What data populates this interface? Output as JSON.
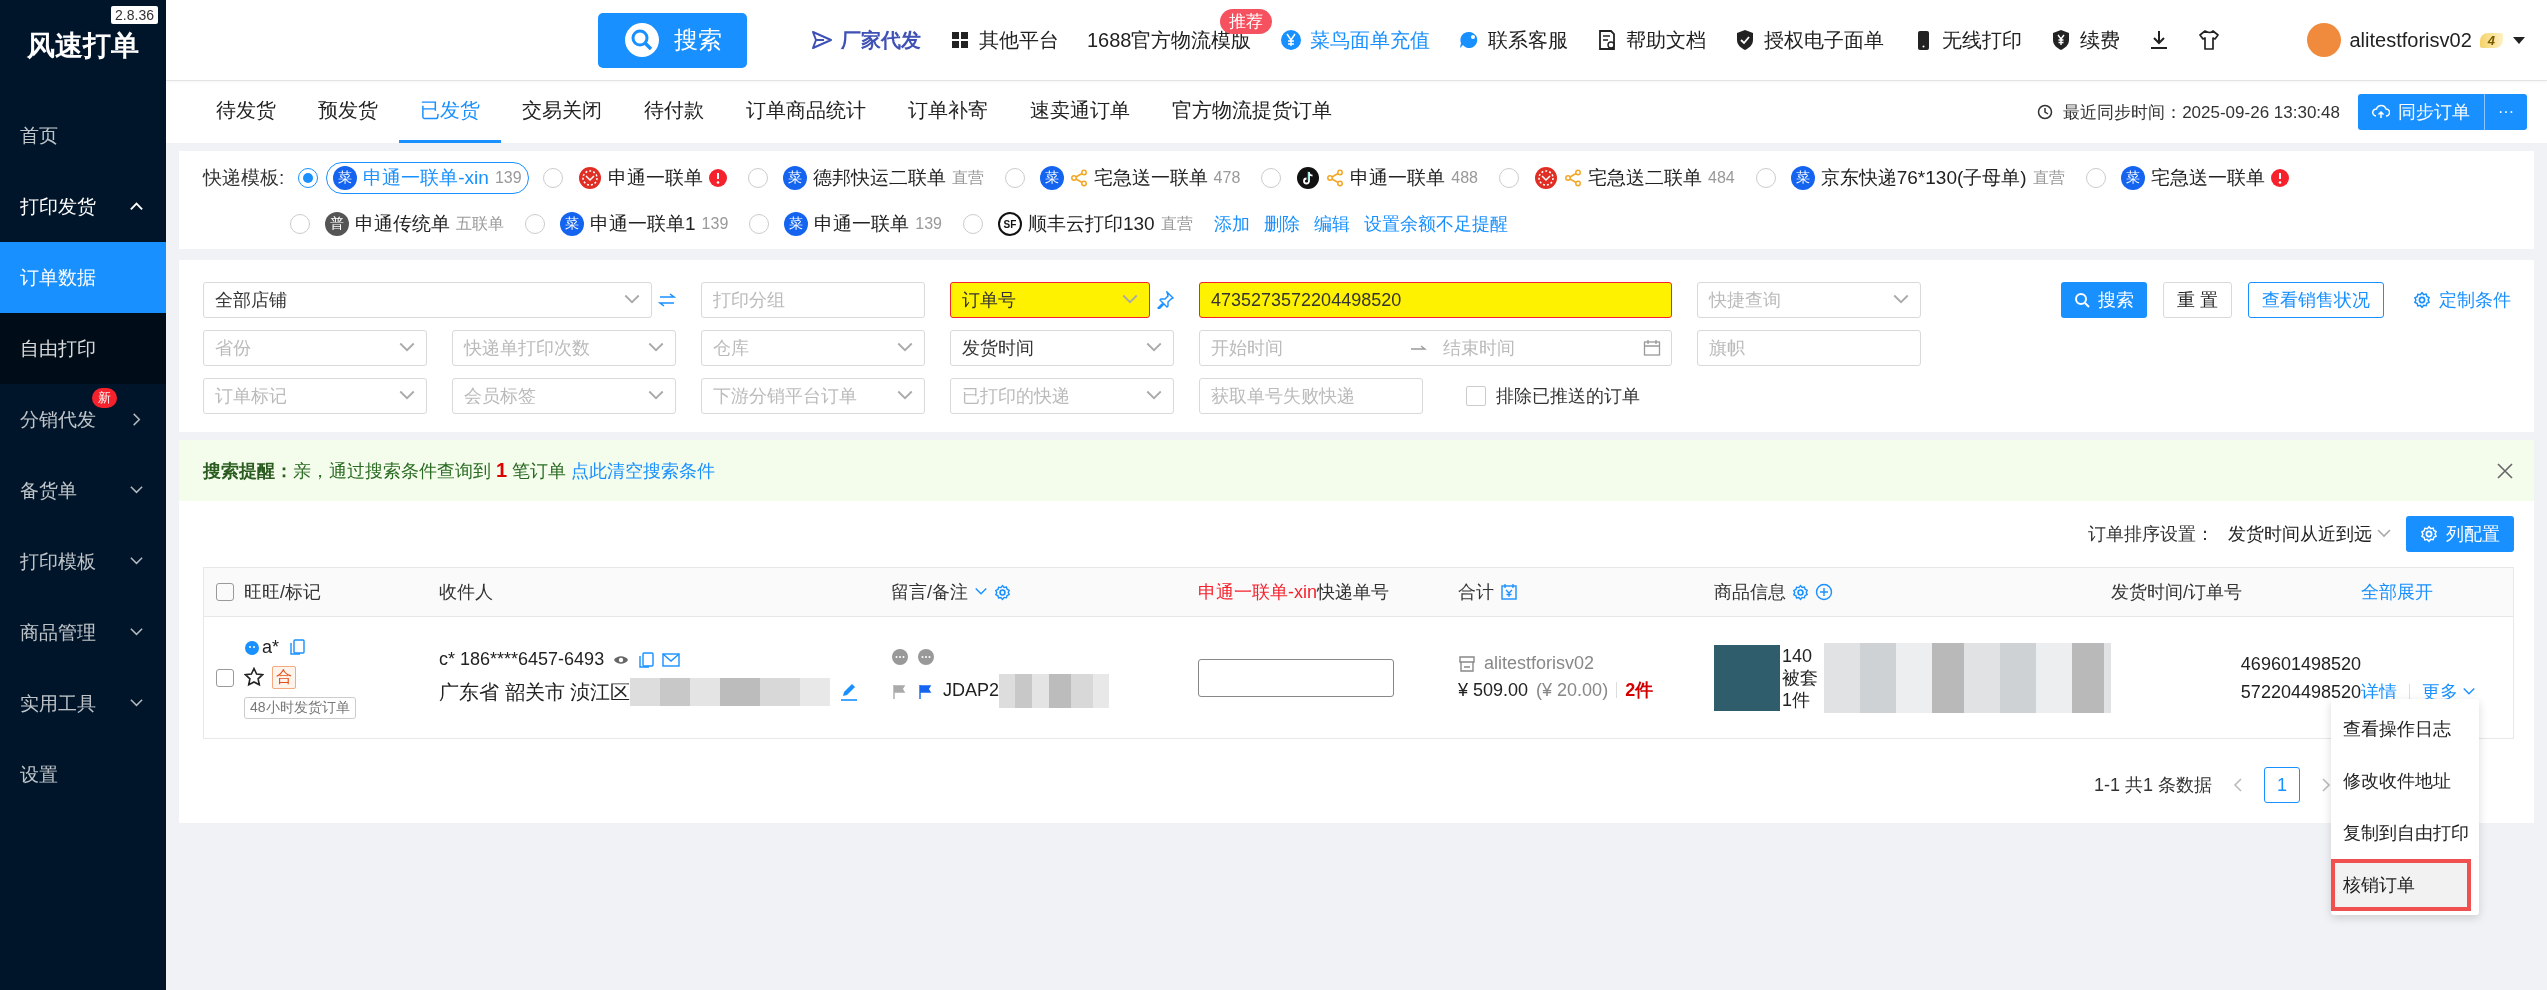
{
  "app": {
    "name": "风速打单",
    "version": "2.8.36"
  },
  "sidebar": {
    "items": [
      {
        "label": "首页",
        "kind": "plain"
      },
      {
        "label": "打印发货",
        "kind": "group",
        "expanded": true,
        "children": [
          {
            "label": "订单数据",
            "selected": true
          },
          {
            "label": "自由打印",
            "selected": false
          }
        ]
      },
      {
        "label": "分销代发",
        "kind": "flyout",
        "badge": "新"
      },
      {
        "label": "备货单",
        "kind": "group",
        "expanded": false
      },
      {
        "label": "打印模板",
        "kind": "group",
        "expanded": false
      },
      {
        "label": "商品管理",
        "kind": "group",
        "expanded": false
      },
      {
        "label": "实用工具",
        "kind": "group",
        "expanded": false
      },
      {
        "label": "设置",
        "kind": "plain"
      }
    ]
  },
  "topbar": {
    "search_button": "搜索",
    "links": [
      {
        "label": "厂家代发",
        "kind": "send"
      },
      {
        "label": "其他平台",
        "kind": "grid"
      },
      {
        "label": "1688官方物流模版",
        "kind": "text",
        "badge": "推荐"
      },
      {
        "label": "菜鸟面单充值",
        "kind": "yen"
      },
      {
        "label": "联系客服",
        "kind": "chat"
      },
      {
        "label": "帮助文档",
        "kind": "doc"
      },
      {
        "label": "授权电子面单",
        "kind": "shield"
      },
      {
        "label": "无线打印",
        "kind": "phone"
      },
      {
        "label": "续费",
        "kind": "renew"
      }
    ],
    "user": {
      "name": "alitestforisv02",
      "vip_badge": "4"
    }
  },
  "tabs": [
    {
      "label": "待发货",
      "selected": false
    },
    {
      "label": "预发货",
      "selected": false
    },
    {
      "label": "已发货",
      "selected": true
    },
    {
      "label": "交易关闭",
      "selected": false
    },
    {
      "label": "待付款",
      "selected": false
    },
    {
      "label": "订单商品统计",
      "selected": false
    },
    {
      "label": "订单补寄",
      "selected": false
    },
    {
      "label": "速卖通订单",
      "selected": false
    },
    {
      "label": "官方物流提货订单",
      "selected": false
    }
  ],
  "sync": {
    "text": "最近同步时间：2025-09-26 13:30:48",
    "button": "同步订单",
    "more": "···"
  },
  "templates": {
    "label": "快递模板:",
    "items": [
      {
        "name": "申通一联单-xin",
        "note": "139",
        "kind": "cainiao",
        "logo_text": "菜",
        "shared": false,
        "alert": false,
        "selected": true
      },
      {
        "name": "申通一联单",
        "kind": "pdd",
        "shared": false,
        "alert": true,
        "selected": false
      },
      {
        "name": "德邦快运二联单",
        "note": "直营",
        "kind": "cainiao",
        "logo_text": "菜",
        "shared": false,
        "alert": false,
        "selected": false
      },
      {
        "name": "宅急送一联单",
        "note": "478",
        "kind": "cainiao",
        "logo_text": "菜",
        "shared": true,
        "alert": false,
        "selected": false
      },
      {
        "name": "申通一联单",
        "note": "488",
        "kind": "douyin",
        "shared": true,
        "alert": false,
        "selected": false
      },
      {
        "name": "宅急送二联单",
        "note": "484",
        "kind": "pdd",
        "shared": true,
        "alert": false,
        "selected": false
      },
      {
        "name": "京东快递76*130(子母单)",
        "note": "直营",
        "kind": "cainiao",
        "logo_text": "菜",
        "shared": false,
        "alert": false,
        "selected": false
      },
      {
        "name": "宅急送一联单",
        "kind": "cainiao",
        "logo_text": "菜",
        "shared": false,
        "alert": true,
        "selected": false
      },
      {
        "name": "申通传统单",
        "note": "五联单",
        "kind": "plain",
        "logo_text": "普",
        "shared": false,
        "alert": false,
        "selected": false
      },
      {
        "name": "申通一联单1",
        "note": "139",
        "kind": "cainiao",
        "logo_text": "菜",
        "shared": false,
        "alert": false,
        "selected": false
      },
      {
        "name": "申通一联单",
        "note": "139",
        "kind": "cainiao",
        "logo_text": "菜",
        "shared": false,
        "alert": false,
        "selected": false
      },
      {
        "name": "顺丰云打印130",
        "note": "直营",
        "kind": "sf",
        "logo_text": "SF",
        "shared": false,
        "alert": false,
        "selected": false
      }
    ],
    "actions": [
      "添加",
      "删除",
      "编辑",
      "设置余额不足提醒"
    ]
  },
  "filters": {
    "fields": [
      {
        "kind": "shop-select",
        "value": "全部店铺",
        "highlighted": false
      },
      {
        "kind": "input",
        "placeholder": "打印分组",
        "highlighted": false
      },
      {
        "kind": "key-select",
        "value": "订单号",
        "highlighted": true
      },
      {
        "kind": "key-input",
        "value": "4735273572204498520",
        "highlighted": true
      },
      {
        "kind": "select",
        "placeholder": "快捷查询",
        "highlighted": false
      },
      {
        "kind": "select",
        "placeholder": "省份",
        "highlighted": false
      },
      {
        "kind": "select",
        "placeholder": "快递单打印次数",
        "highlighted": false
      },
      {
        "kind": "select",
        "placeholder": "仓库",
        "highlighted": false
      },
      {
        "kind": "select",
        "value": "发货时间",
        "highlighted": false
      },
      {
        "kind": "date-range",
        "placeholder": "开始时间",
        "placeholder_end": "结束时间",
        "highlighted": false
      },
      {
        "kind": "input",
        "placeholder": "旗帜",
        "highlighted": false
      },
      {
        "kind": "select",
        "placeholder": "订单标记",
        "highlighted": false
      },
      {
        "kind": "select",
        "placeholder": "会员标签",
        "highlighted": false
      },
      {
        "kind": "select",
        "placeholder": "下游分销平台订单",
        "highlighted": false
      },
      {
        "kind": "select",
        "placeholder": "已打印的快递",
        "highlighted": false
      },
      {
        "kind": "input",
        "placeholder": "获取单号失败快递",
        "highlighted": false
      },
      {
        "kind": "checkbox",
        "label": "排除已推送的订单",
        "checked": false
      }
    ],
    "buttons": [
      {
        "label": "搜索",
        "kind": "primary"
      },
      {
        "label": "重 置",
        "kind": "default"
      },
      {
        "label": "查看销售状况",
        "kind": "outline"
      },
      {
        "label": "定制条件",
        "kind": "link"
      }
    ]
  },
  "hint": {
    "text": "**搜索提醒：**亲，通过搜索条件查询到 **1** 笔订单",
    "link": "点此清空搜索条件"
  },
  "sort": {
    "label": "订单排序设置：",
    "value": "发货时间从近到远",
    "button": "列配置"
  },
  "table": {
    "select_all": false,
    "columns": [
      "旺旺/标记",
      "收件人",
      "留言/备注",
      "**申通一联单-xin**快递单号",
      "合计",
      "商品信息",
      "发货时间/订单号"
    ],
    "expand_all": "全部展开",
    "rows": [
      {
        "checked": false,
        "buyer": "a*",
        "starred": false,
        "tag": "合",
        "label_tag": "48小时发货订单",
        "recipient": "c* 186****6457-6493",
        "address": "广东省 韶关市 浈江区",
        "memo": "JDAP2",
        "shop": "alitestforisv02",
        "amount": "¥ 509.00",
        "discount": "(¥ 20.00)",
        "count": "2件",
        "product_lines": [
          "140",
          "被套",
          "1件"
        ],
        "order_lines": [
          "469601498520",
          "572204498520"
        ],
        "detail": "详情",
        "more": "更多"
      }
    ]
  },
  "menu": [
    {
      "label": "查看操作日志",
      "highlighted": false
    },
    {
      "label": "修改收件地址",
      "highlighted": false
    },
    {
      "label": "复制到自由打印",
      "highlighted": false
    },
    {
      "label": "核销订单",
      "highlighted": true
    }
  ],
  "pagination": {
    "summary": "1-1 共1 条数据",
    "pages": [
      {
        "label": "1",
        "selected": true
      }
    ]
  }
}
